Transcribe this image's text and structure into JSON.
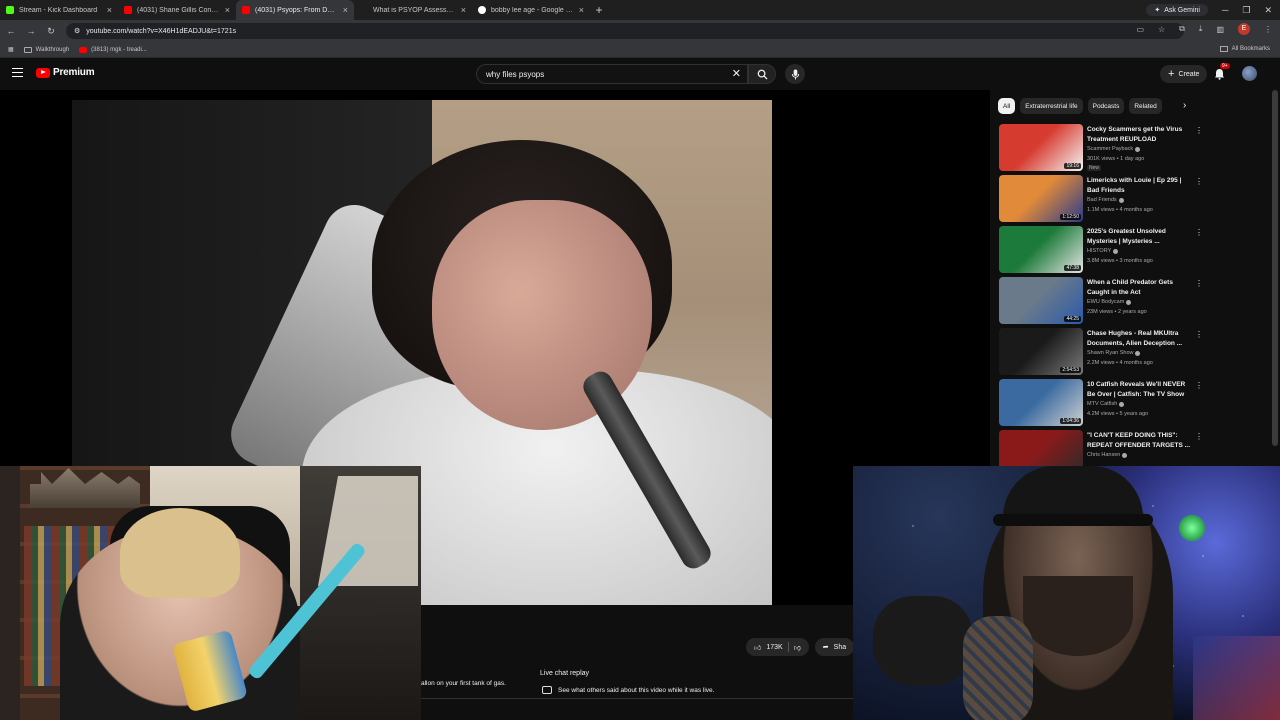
{
  "browser": {
    "tabs": [
      {
        "title": "Stream - Kick Dashboard",
        "favicon_color": "#53fc18",
        "active": false
      },
      {
        "title": "(4031) Shane Gillis Confronts B",
        "favicon_color": "#ff0000",
        "active": false
      },
      {
        "title": "(4031) Psyops: From Dead Bab",
        "favicon_color": "#ff0000",
        "active": true
      },
      {
        "title": "What is PSYOP Assessment an",
        "favicon_color": "#3c6fd1",
        "active": false
      },
      {
        "title": "bobby lee age - Google Search",
        "favicon_color": "#ffffff",
        "active": false
      }
    ],
    "new_tab": "+",
    "ask_gemini": "Ask Gemini",
    "url": "youtube.com/watch?v=X46H1dEADJU&t=1721s",
    "profile_letter": "E",
    "bookmarks": [
      {
        "label": "Walkthrough",
        "type": "folder"
      },
      {
        "label": "(3813) mgk - treadi...",
        "type": "youtube"
      }
    ],
    "all_bookmarks": "All Bookmarks"
  },
  "youtube": {
    "logo_text": "Premium",
    "search": {
      "value": "why files psyops"
    },
    "create_label": "Create",
    "notifications_badge": "9+",
    "actions": {
      "likes": "173K",
      "share": "Sha"
    },
    "description_snippet": "allon on your first tank of gas.",
    "live_chat": {
      "title": "Live chat replay",
      "subtitle": "See what others said about this video while it was live."
    },
    "chips": [
      "All",
      "Extraterrestrial life",
      "Podcasts",
      "Related"
    ],
    "recommendations": [
      {
        "title": "Cocky Scammers get the Virus Treatment REUPLOAD",
        "channel": "Scammer Payback",
        "meta": "301K views • 1 day ago",
        "badge": "New",
        "duration": "19:16",
        "thumb": [
          "#d63b2f",
          "#f5f5f5"
        ]
      },
      {
        "title": "Limericks with Louie | Ep 295 | Bad Friends",
        "channel": "Bad Friends",
        "meta": "1.1M views • 4 months ago",
        "badge": "",
        "duration": "1:12:50",
        "thumb": [
          "#e08a3a",
          "#2a3c8a"
        ]
      },
      {
        "title": "2025's Greatest Unsolved Mysteries | Mysteries ...",
        "channel": "HISTORY",
        "meta": "3.8M views • 3 months ago",
        "badge": "",
        "duration": "47:38",
        "thumb": [
          "#1c7a3a",
          "#e6e6e6"
        ]
      },
      {
        "title": "When a Child Predator Gets Caught in the Act",
        "channel": "EWU Bodycam",
        "meta": "23M views • 2 years ago",
        "badge": "",
        "duration": "44:25",
        "thumb": [
          "#6a7a8a",
          "#2a5aaa"
        ]
      },
      {
        "title": "Chase Hughes - Real MKUltra Documents, Alien Deception ...",
        "channel": "Shawn Ryan Show",
        "meta": "2.2M views • 4 months ago",
        "badge": "",
        "duration": "2:54:53",
        "thumb": [
          "#1a1a1a",
          "#7a7a7a"
        ]
      },
      {
        "title": "10 Catfish Reveals We'll NEVER Be Over | Catfish: The TV Show",
        "channel": "MTV Catfish",
        "meta": "4.2M views • 5 years ago",
        "badge": "",
        "duration": "1:04:36",
        "thumb": [
          "#3a6aa0",
          "#d0d0d0"
        ]
      },
      {
        "title": "\"I CAN'T KEEP DOING THIS\": REPEAT OFFENDER TARGETS ...",
        "channel": "Chris Hansen",
        "meta": "",
        "badge": "",
        "duration": "",
        "thumb": [
          "#8a1a1a",
          "#2a2a2a"
        ]
      }
    ]
  }
}
